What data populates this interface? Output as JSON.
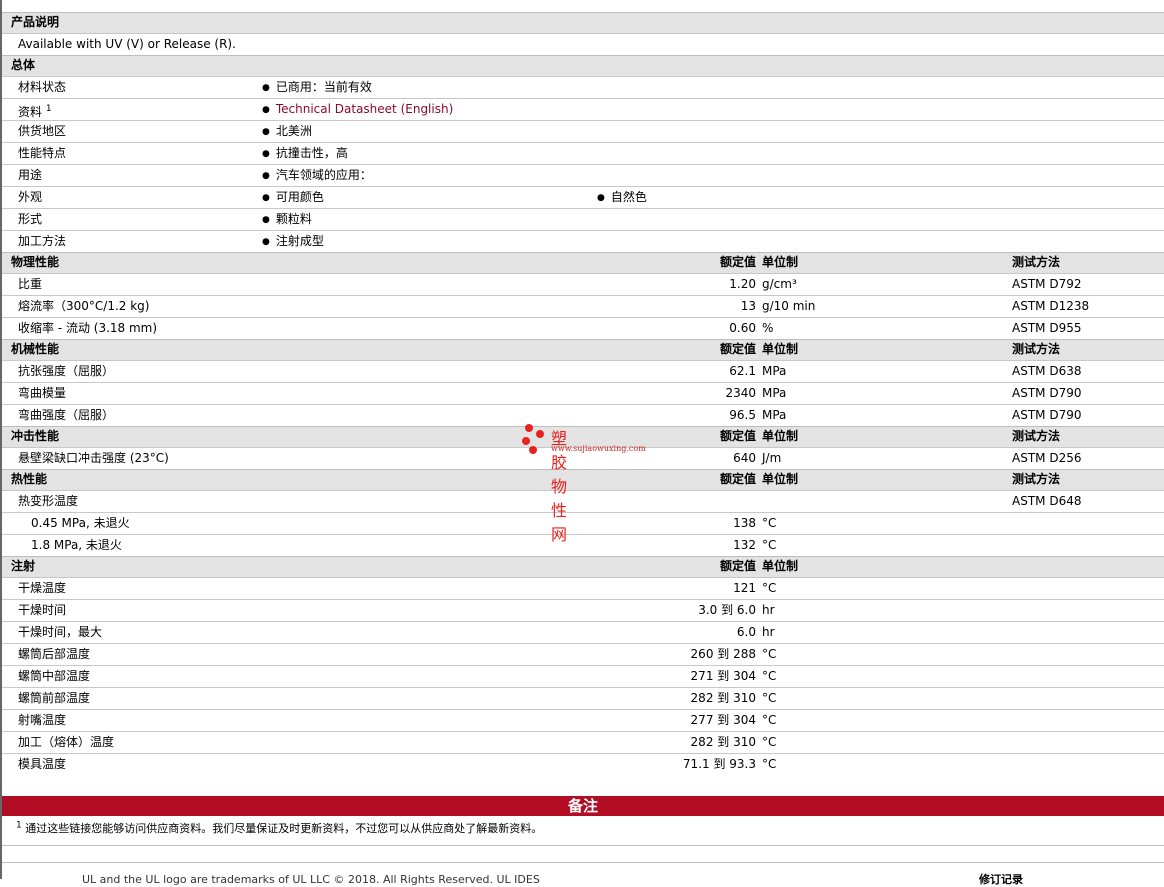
{
  "sections": [
    {
      "title": "产品说明",
      "rows": [
        {
          "label": "Available with UV (V) or Release (R)."
        }
      ]
    },
    {
      "title": "总体",
      "rows": [
        {
          "label": "材料状态",
          "b1": "已商用：当前有效"
        },
        {
          "label": "资料",
          "sup": "1",
          "b1": "Technical Datasheet (English)",
          "link": true
        },
        {
          "label": "供货地区",
          "b1": "北美洲"
        },
        {
          "label": "性能特点",
          "b1": "抗撞击性，高"
        },
        {
          "label": "用途",
          "b1": "汽车领域的应用："
        },
        {
          "label": "外观",
          "b1": "可用颜色",
          "b2": "自然色"
        },
        {
          "label": "形式",
          "b1": "颗粒料"
        },
        {
          "label": "加工方法",
          "b1": "注射成型"
        }
      ]
    },
    {
      "title": "物理性能",
      "h": true,
      "rows": [
        {
          "label": "比重",
          "val": "1.20",
          "unit": "g/cm³",
          "meth": "ASTM D792"
        },
        {
          "label": "熔流率（300°C/1.2 kg)",
          "val": "13",
          "unit": "g/10 min",
          "meth": "ASTM D1238"
        },
        {
          "label": "收缩率 - 流动 (3.18 mm)",
          "val": "0.60",
          "unit": "%",
          "meth": "ASTM D955"
        }
      ]
    },
    {
      "title": "机械性能",
      "h": true,
      "rows": [
        {
          "label": "抗张强度（屈服）",
          "val": "62.1",
          "unit": "MPa",
          "meth": "ASTM D638"
        },
        {
          "label": "弯曲模量",
          "val": "2340",
          "unit": "MPa",
          "meth": "ASTM D790"
        },
        {
          "label": "弯曲强度（屈服）",
          "val": "96.5",
          "unit": "MPa",
          "meth": "ASTM D790"
        }
      ]
    },
    {
      "title": "冲击性能",
      "h": true,
      "rows": [
        {
          "label": "悬壁梁缺口冲击强度 (23°C)",
          "val": "640",
          "unit": "J/m",
          "meth": "ASTM D256"
        }
      ]
    },
    {
      "title": "热性能",
      "h": true,
      "rows": [
        {
          "label": "热变形温度",
          "meth": "ASTM D648"
        },
        {
          "label": "0.45 MPa, 未退火",
          "val": "138",
          "unit": "°C",
          "ind": true
        },
        {
          "label": "1.8 MPa, 未退火",
          "val": "132",
          "unit": "°C",
          "ind": true
        }
      ]
    },
    {
      "title": "注射",
      "h": true,
      "hm": false,
      "rows": [
        {
          "label": "干燥温度",
          "val": "121",
          "unit": "°C"
        },
        {
          "label": "干燥时间",
          "val": "3.0 到  6.0",
          "unit": "hr"
        },
        {
          "label": "干燥时间，最大",
          "val": "6.0",
          "unit": "hr"
        },
        {
          "label": "螺筒后部温度",
          "val": "260 到  288",
          "unit": "°C"
        },
        {
          "label": "螺筒中部温度",
          "val": "271 到  304",
          "unit": "°C"
        },
        {
          "label": "螺筒前部温度",
          "val": "282 到  310",
          "unit": "°C"
        },
        {
          "label": "射嘴温度",
          "val": "277 到  304",
          "unit": "°C"
        },
        {
          "label": "加工（熔体）温度",
          "val": "282 到  310",
          "unit": "°C"
        },
        {
          "label": "模具温度",
          "val": "71.1 到  93.3",
          "unit": "°C"
        }
      ]
    }
  ],
  "headers": {
    "val": "额定值",
    "unit": "单位制",
    "meth": "测试方法"
  },
  "notes": {
    "title": "备注",
    "sup": "1",
    "text": "通过这些链接您能够访问供应商资料。我们尽量保证及时更新资料，不过您可以从供应商处了解最新资料。"
  },
  "footer": {
    "text": "UL and the UL logo are trademarks of UL LLC © 2018. All Rights Reserved. UL IDES",
    "right": "修订记录"
  },
  "watermark": {
    "name": "塑胶物性网",
    "url": "www.sujiaowuxing.com"
  }
}
